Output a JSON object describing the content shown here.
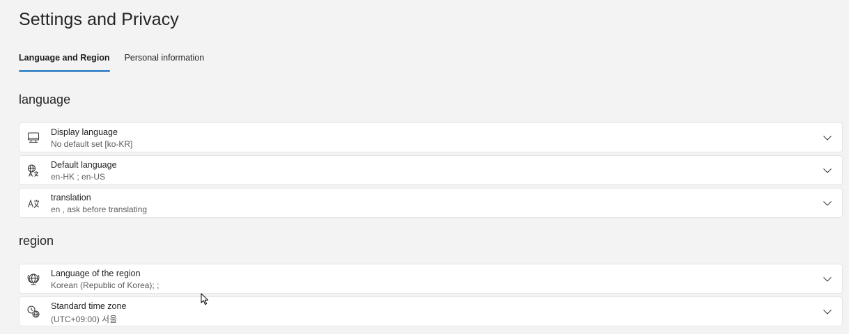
{
  "page": {
    "title": "Settings and Privacy"
  },
  "tabs": [
    {
      "label": "Language and Region",
      "active": true
    },
    {
      "label": "Personal information",
      "active": false
    }
  ],
  "sections": {
    "language": {
      "heading": "language",
      "items": [
        {
          "title": "Display language",
          "subtitle": "No default set [ko-KR]",
          "icon": "monitor-icon"
        },
        {
          "title": "Default language",
          "subtitle": "en-HK ; en-US",
          "icon": "language-icon"
        },
        {
          "title": "translation",
          "subtitle": "en , ask before translating",
          "icon": "translate-icon"
        }
      ]
    },
    "region": {
      "heading": "region",
      "items": [
        {
          "title": "Language of the region",
          "subtitle": "Korean (Republic of Korea); ;",
          "icon": "globe-icon"
        },
        {
          "title": "Standard time zone",
          "subtitle": "(UTC+09:00) 서울",
          "icon": "time-zone-icon"
        }
      ]
    }
  },
  "colors": {
    "background": "#f3f3f3",
    "card": "#ffffff",
    "accent": "#0f6cbd"
  }
}
